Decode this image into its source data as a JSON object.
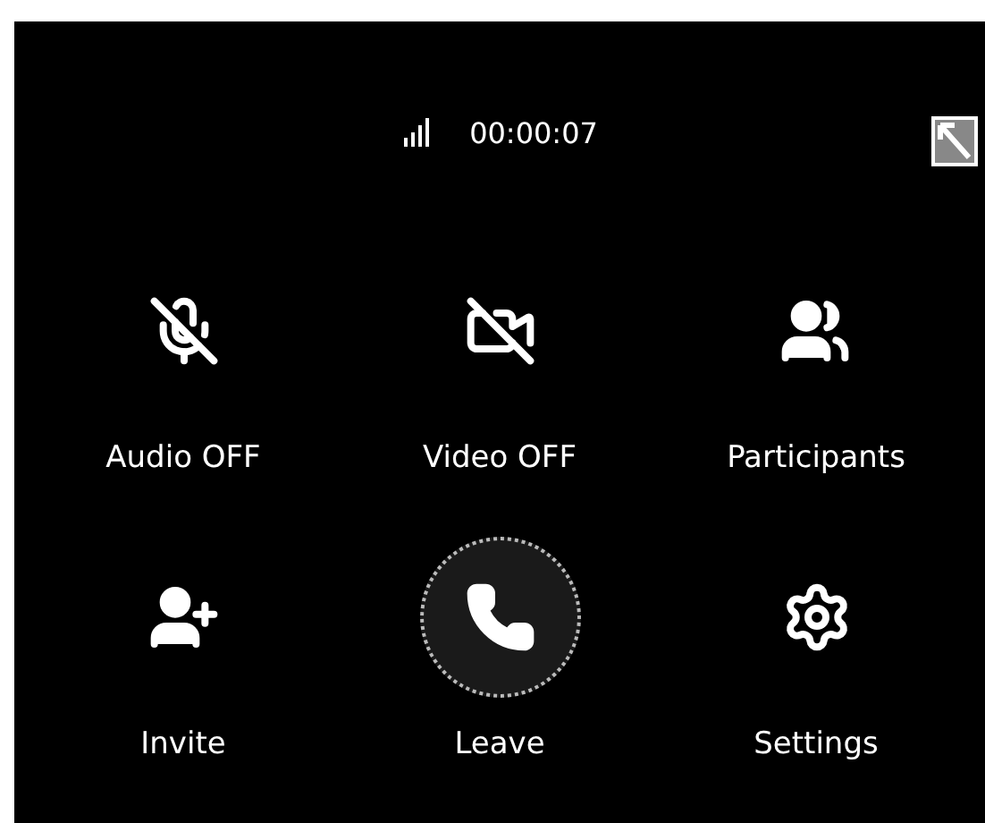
{
  "status": {
    "timer": "00:00:07"
  },
  "controls": [
    {
      "kind": "mic-off",
      "label": "Audio OFF",
      "highlighted": false
    },
    {
      "kind": "video-off",
      "label": "Video OFF",
      "highlighted": false
    },
    {
      "kind": "people",
      "label": "Participants",
      "highlighted": false
    },
    {
      "kind": "add-person",
      "label": "Invite",
      "highlighted": false
    },
    {
      "kind": "phone",
      "label": "Leave",
      "highlighted": true
    },
    {
      "kind": "gear",
      "label": "Settings",
      "highlighted": false
    }
  ]
}
